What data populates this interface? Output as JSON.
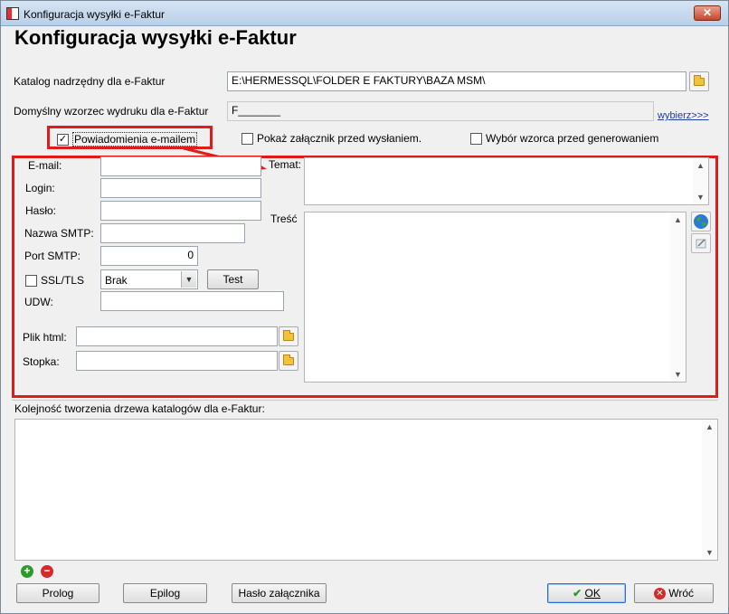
{
  "window": {
    "title": "Konfiguracja wysyłki e-Faktur",
    "close_label": "✕"
  },
  "header": {
    "title": "Konfiguracja wysyłki e-Faktur"
  },
  "catalog": {
    "label": "Katalog nadrzędny dla e-Faktur",
    "value": "E:\\HERMESSQL\\FOLDER E FAKTURY\\BAZA MSM\\"
  },
  "template": {
    "label": "Domyślny wzorzec wydruku dla e-Faktur",
    "value": "F_______",
    "choose_link": "wybierz>>>"
  },
  "options": {
    "email_notifications": {
      "label": "Powiadomienia e-mailem",
      "checked": true
    },
    "show_attachment": {
      "label": "Pokaż załącznik przed wysłaniem.",
      "checked": false
    },
    "choose_template": {
      "label": "Wybór wzorca przed generowaniem",
      "checked": false
    }
  },
  "email": {
    "email_label": "E-mail:",
    "email_value": "",
    "login_label": "Login:",
    "login_value": "",
    "password_label": "Hasło:",
    "password_value": "",
    "smtp_name_label": "Nazwa SMTP:",
    "smtp_name_value": "",
    "smtp_port_label": "Port SMTP:",
    "smtp_port_value": "0",
    "ssl_label": "SSL/TLS",
    "ssl_checked": false,
    "ssl_mode": "Brak",
    "test_label": "Test",
    "cc_label": "UDW:",
    "cc_value": "",
    "html_file_label": "Plik html:",
    "html_file_value": "",
    "footer_label": "Stopka:",
    "footer_value": "",
    "subject_label": "Temat:",
    "subject_value": "",
    "body_label": "Treść",
    "body_value": ""
  },
  "tree": {
    "label": "Kolejność tworzenia drzewa katalogów dla e-Faktur:",
    "items": []
  },
  "buttons": {
    "prolog": "Prolog",
    "epilog": "Epilog",
    "attachment_password": "Hasło załącznika",
    "ok": "OK",
    "back": "Wróć"
  },
  "colors": {
    "highlight": "#e01b1b",
    "link": "#1e3aa8",
    "ok_border": "#2a6fd6"
  }
}
